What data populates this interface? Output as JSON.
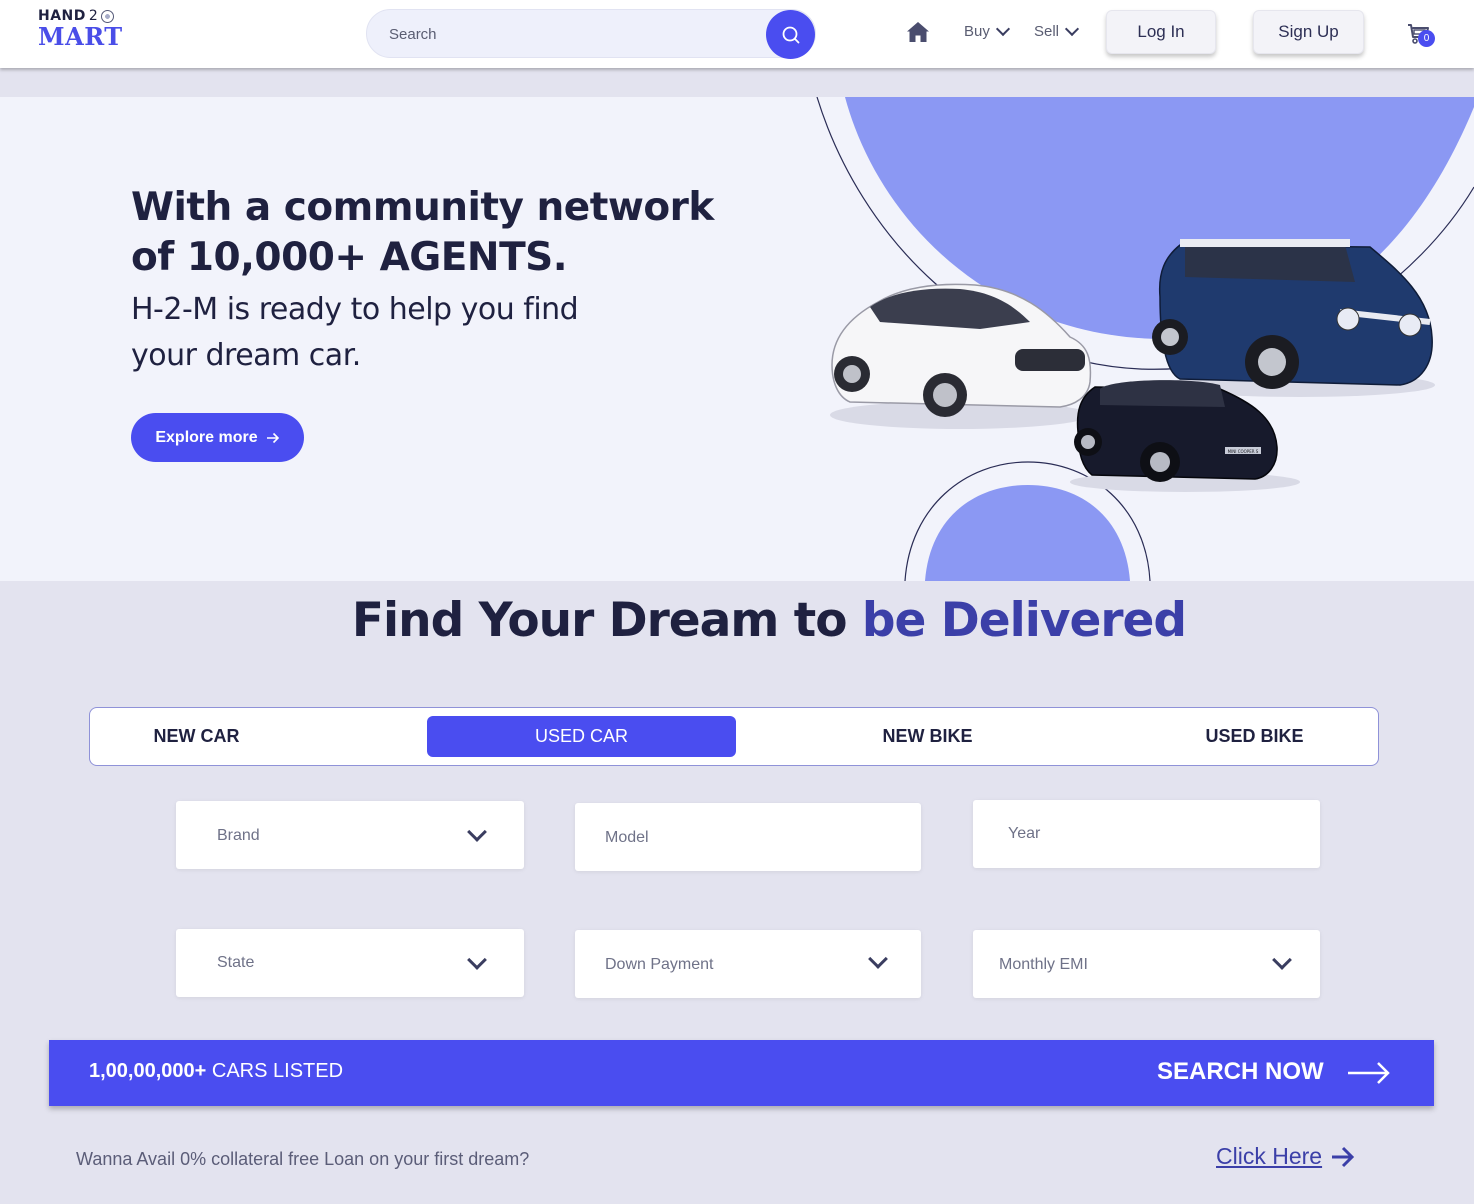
{
  "header": {
    "logo_top": "HAND",
    "logo_two": "2",
    "logo_bottom": "MART",
    "search_placeholder": "Search",
    "nav": {
      "buy": "Buy",
      "sell": "Sell"
    },
    "login": "Log In",
    "signup": "Sign Up",
    "cart_count": "0"
  },
  "hero": {
    "title_line1": "With a community network",
    "title_line2": "of 10,000+ AGENTS.",
    "subtitle_line1": "H-2-M is ready to help you find",
    "subtitle_line2": "your dream car.",
    "cta": "Explore more",
    "car_plate": "MINI COOPER S"
  },
  "section": {
    "title_main": "Find Your Dream to ",
    "title_accent": "be Delivered"
  },
  "tabs": [
    "NEW CAR",
    "USED CAR",
    "NEW BIKE",
    "USED BIKE"
  ],
  "active_tab": "USED CAR",
  "filters": {
    "brand": "Brand",
    "model": "Model",
    "year": "Year",
    "state": "State",
    "down_payment": "Down Payment",
    "monthly_emi": "Monthly EMI"
  },
  "cta_bar": {
    "count": "1,00,00,000+",
    "count_suffix": " CARS LISTED",
    "search": "SEARCH NOW"
  },
  "loan": {
    "text": "Wanna Avail 0% collateral free Loan on your first dream?",
    "link": "Click Here"
  },
  "colors": {
    "accent": "#4a4df0",
    "accent_dark": "#3b3fa8",
    "hero_blob": "#8b98f3",
    "text_dark": "#1f2140"
  },
  "icons": [
    "search-icon",
    "home-icon",
    "chevron-down-icon",
    "cart-icon",
    "arrow-right-icon"
  ]
}
